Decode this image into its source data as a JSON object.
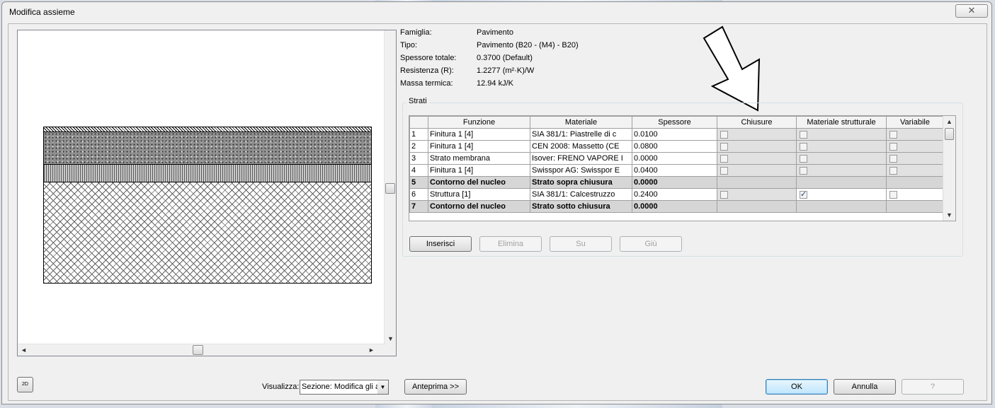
{
  "window": {
    "title": "Modifica assieme",
    "close_icon": "close-icon"
  },
  "info": {
    "famiglia_label": "Famiglia:",
    "famiglia_value": "Pavimento",
    "tipo_label": "Tipo:",
    "tipo_value": "Pavimento (B20 - (M4) - B20)",
    "spessore_label": "Spessore totale:",
    "spessore_value": "0.3700 (Default)",
    "resistenza_label": "Resistenza (R):",
    "resistenza_value": "1.2277 (m²·K)/W",
    "massa_label": "Massa termica:",
    "massa_value": "12.94 kJ/K"
  },
  "strati": {
    "label": "Strati",
    "columns": [
      "Funzione",
      "Materiale",
      "Spessore",
      "Chiusure",
      "Materiale strutturale",
      "Variabile"
    ],
    "rows": [
      {
        "n": "1",
        "funzione": "Finitura 1 [4]",
        "materiale": "SIA 381/1: Piastrelle di c",
        "spessore": "0.0100",
        "chiusure": false,
        "strutturale": false,
        "variabile": false,
        "core": false
      },
      {
        "n": "2",
        "funzione": "Finitura 1 [4]",
        "materiale": "CEN 2008: Massetto (CE",
        "spessore": "0.0800",
        "chiusure": false,
        "strutturale": false,
        "variabile": false,
        "core": false
      },
      {
        "n": "3",
        "funzione": "Strato membrana",
        "materiale": "Isover: FRENO VAPORE I",
        "spessore": "0.0000",
        "chiusure": false,
        "strutturale": false,
        "variabile": false,
        "core": false
      },
      {
        "n": "4",
        "funzione": "Finitura 1 [4]",
        "materiale": "Swisspor AG: Swisspor E",
        "spessore": "0.0400",
        "chiusure": false,
        "strutturale": false,
        "variabile": false,
        "core": false
      },
      {
        "n": "5",
        "funzione": "Contorno del nucleo",
        "materiale": "Strato sopra chiusura",
        "spessore": "0.0000",
        "core": true
      },
      {
        "n": "6",
        "funzione": "Struttura [1]",
        "materiale": "SIA 381/1: Calcestruzzo",
        "spessore": "0.2400",
        "chiusure": false,
        "strutturale": true,
        "variabile": false,
        "core": false
      },
      {
        "n": "7",
        "funzione": "Contorno del nucleo",
        "materiale": "Strato sotto chiusura",
        "spessore": "0.0000",
        "core": true
      }
    ]
  },
  "buttons": {
    "inserisci": "Inserisci",
    "elimina": "Elimina",
    "su": "Su",
    "giu": "Giù",
    "anteprima": "Anteprima >>",
    "ok": "OK",
    "annulla": "Annulla",
    "help": "?"
  },
  "view": {
    "label": "Visualizza:",
    "selected": "Sezione: Modifica gli a",
    "toggle_icon": "2d-view-icon",
    "toggle_text": "2D"
  },
  "annotation": {
    "arrow_icon": "down-arrow-annotation"
  }
}
